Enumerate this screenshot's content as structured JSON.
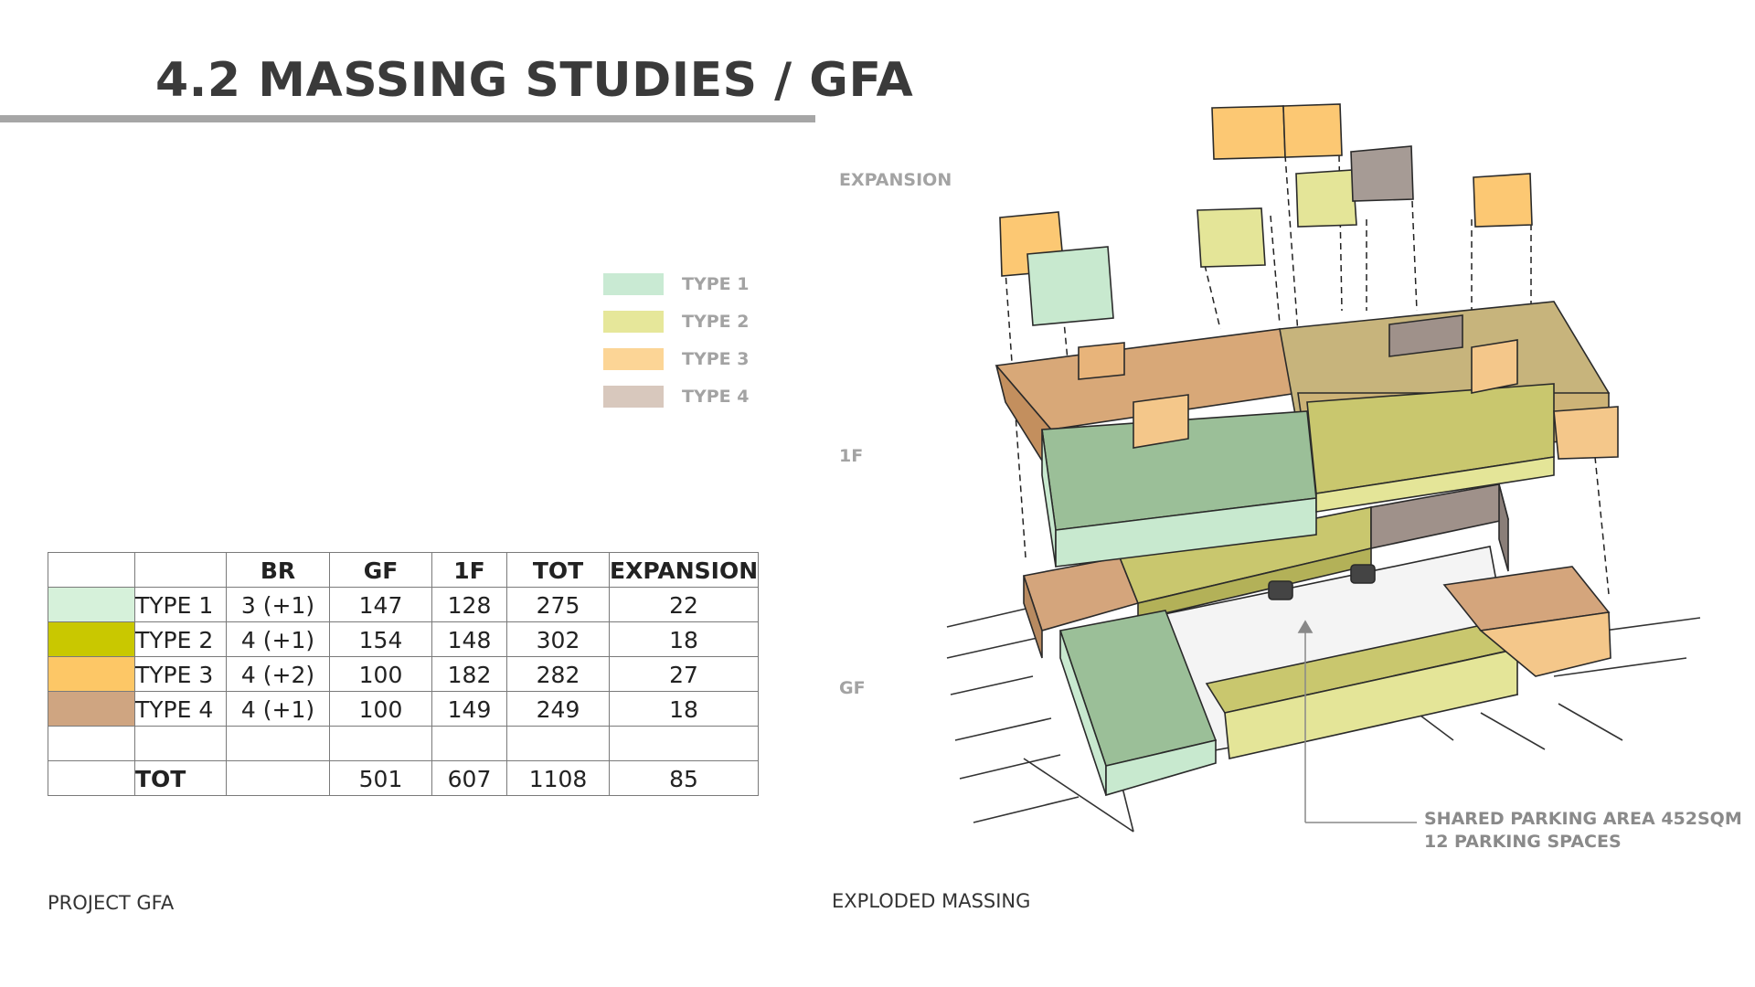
{
  "header": {
    "title": "4.2 MASSING STUDIES / GFA"
  },
  "legend": [
    {
      "label": "TYPE 1",
      "color": "#c9ead3"
    },
    {
      "label": "TYPE 2",
      "color": "#e6e79a"
    },
    {
      "label": "TYPE 3",
      "color": "#fcd596"
    },
    {
      "label": "TYPE 4",
      "color": "#d8c8bd"
    }
  ],
  "gfa_table": {
    "headers": [
      "BR",
      "GF",
      "1F",
      "TOT",
      "EXPANSION"
    ],
    "rows": [
      {
        "name": "TYPE 1",
        "color": "#d6f1da",
        "br": "3 (+1)",
        "gf": "147",
        "f1": "128",
        "tot": "275",
        "exp": "22"
      },
      {
        "name": "TYPE 2",
        "color": "#c9c800",
        "br": "4 (+1)",
        "gf": "154",
        "f1": "148",
        "tot": "302",
        "exp": "18"
      },
      {
        "name": "TYPE 3",
        "color": "#fdc766",
        "br": "4 (+2)",
        "gf": "100",
        "f1": "182",
        "tot": "282",
        "exp": "27"
      },
      {
        "name": "TYPE 4",
        "color": "#cfa581",
        "br": "4 (+1)",
        "gf": "100",
        "f1": "149",
        "tot": "249",
        "exp": "18"
      }
    ],
    "total": {
      "name": "TOT",
      "gf": "501",
      "f1": "607",
      "tot": "1108",
      "exp": "85"
    }
  },
  "captions": {
    "left": "PROJECT GFA",
    "right": "EXPLODED MASSING"
  },
  "levels": {
    "expansion": "EXPANSION",
    "first": "1F",
    "ground": "GF"
  },
  "parking_note": {
    "line1": "SHARED PARKING AREA 452SQM",
    "line2": "12 PARKING SPACES"
  }
}
